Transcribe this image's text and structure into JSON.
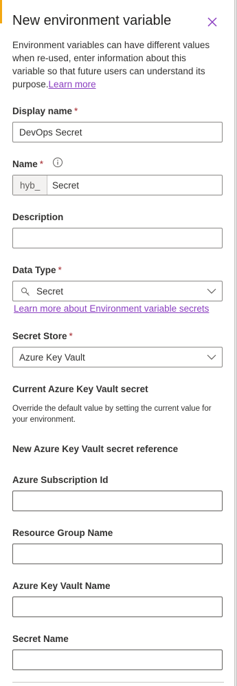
{
  "panel": {
    "title": "New environment variable",
    "description": "Environment variables can have different values when re-used, enter information about this variable so that future users can understand its purpose.",
    "learn_more": "Learn more"
  },
  "fields": {
    "display_name": {
      "label": "Display name",
      "required": "*",
      "value": "DevOps Secret"
    },
    "name": {
      "label": "Name",
      "required": "*",
      "prefix": "hyb_",
      "value": "Secret"
    },
    "description": {
      "label": "Description",
      "value": ""
    },
    "data_type": {
      "label": "Data Type",
      "required": "*",
      "value": "Secret",
      "help_link": "Learn more about Environment variable secrets"
    },
    "secret_store": {
      "label": "Secret Store",
      "required": "*",
      "value": "Azure Key Vault"
    }
  },
  "current_secret": {
    "heading": "Current Azure Key Vault secret",
    "text": "Override the default value by setting the current value for your environment."
  },
  "new_reference": {
    "heading": "New Azure Key Vault secret reference",
    "subscription_label": "Azure Subscription Id",
    "resource_group_label": "Resource Group Name",
    "vault_name_label": "Azure Key Vault Name",
    "secret_name_label": "Secret Name"
  },
  "icons": [
    "close-icon",
    "info-icon",
    "key-icon",
    "chevron-down-icon"
  ],
  "colors": {
    "link": "#8a3ec0",
    "required": "#a4262c",
    "border": "#8a8886",
    "accent": "#f3a712"
  }
}
